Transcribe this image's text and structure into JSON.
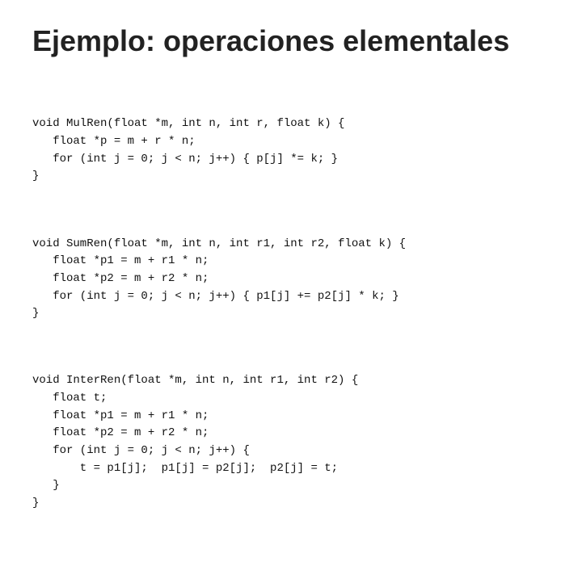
{
  "slide": {
    "title": "Ejemplo: operaciones elementales",
    "sections": [
      {
        "id": "section1",
        "lines": [
          "void MulRen(float *m, int n, int r, float k) {",
          "   float *p = m + r * n;",
          "   for (int j = 0; j < n; j++) { p[j] *= k; }",
          "}"
        ]
      },
      {
        "id": "section2",
        "lines": [
          "void SumRen(float *m, int n, int r1, int r2, float k) {",
          "   float *p1 = m + r1 * n;",
          "   float *p2 = m + r2 * n;",
          "   for (int j = 0; j < n; j++) { p1[j] += p2[j] * k; }",
          "}"
        ]
      },
      {
        "id": "section3",
        "lines": [
          "void InterRen(float *m, int n, int r1, int r2) {",
          "   float t;",
          "   float *p1 = m + r1 * n;",
          "   float *p2 = m + r2 * n;",
          "   for (int j = 0; j < n; j++) {",
          "       t = p1[j];  p1[j] = p2[j];  p2[j] = t;",
          "   }",
          "}"
        ]
      }
    ]
  }
}
